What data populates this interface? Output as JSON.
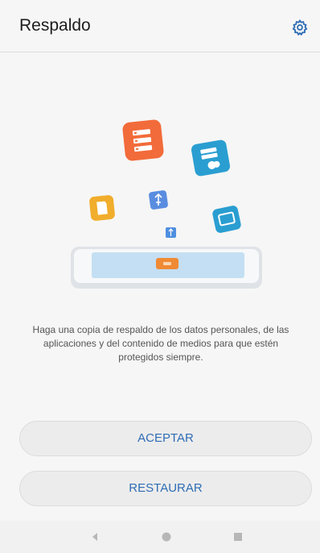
{
  "header": {
    "title": "Respaldo",
    "settings_icon": "gear-icon"
  },
  "main": {
    "description": "Haga una copia de respaldo de los datos personales, de las aplicaciones y del contenido de medios para que estén protegidos siempre."
  },
  "actions": {
    "accept_label": "ACEPTAR",
    "restore_label": "RESTAURAR"
  },
  "navbar": {
    "back_icon": "back-triangle-icon",
    "home_icon": "home-circle-icon",
    "recents_icon": "recents-square-icon"
  },
  "colors": {
    "accent": "#2f6db5",
    "orange": "#f26b3a",
    "teal": "#2a9ed1",
    "yellow": "#f1ad2c",
    "blue": "#3c8fe0"
  }
}
